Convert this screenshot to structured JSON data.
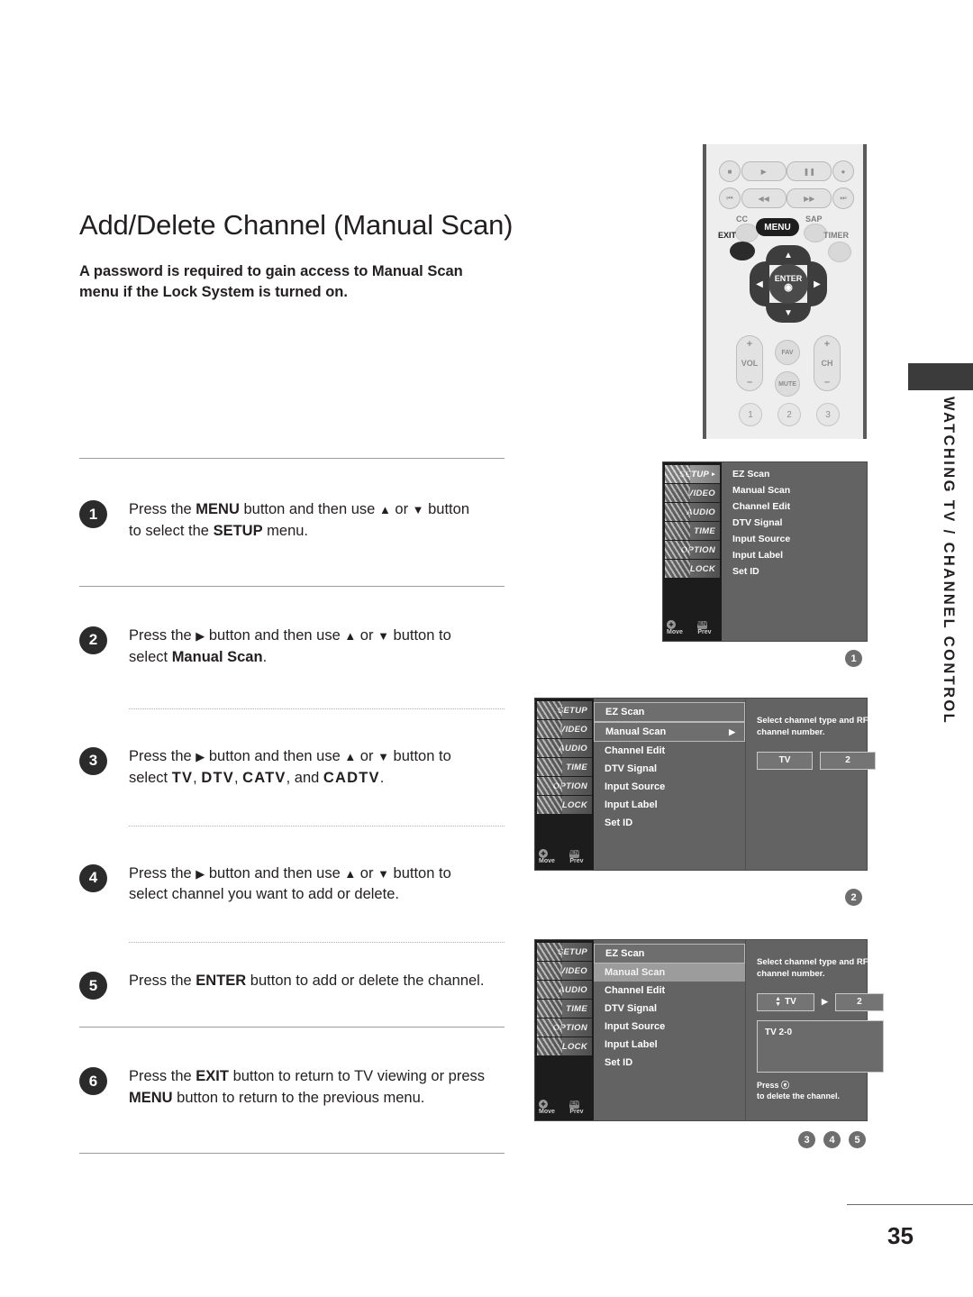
{
  "page": {
    "title": "Add/Delete Channel (Manual Scan)",
    "intro": "A password is required to gain access to Manual Scan menu if the Lock System is turned on.",
    "number": "35",
    "side_tab": "WATCHING TV / CHANNEL CONTROL"
  },
  "steps": [
    {
      "num": "1",
      "parts": [
        {
          "t": "Press the ",
          "b": false
        },
        {
          "t": "MENU",
          "b": true
        },
        {
          "t": " button and then use ",
          "b": false
        },
        {
          "t": "▲",
          "b": false
        },
        {
          "t": " or ",
          "b": false
        },
        {
          "t": "▼",
          "b": false
        },
        {
          "t": " button to select the ",
          "b": false
        },
        {
          "t": "SETUP",
          "b": true
        },
        {
          "t": " menu.",
          "b": false
        }
      ],
      "text": "Press the MENU button and then use ▲ or ▼ button to select the SETUP menu."
    },
    {
      "num": "2",
      "text": "Press the ▶ button and then use ▲ or ▼ button to select Manual Scan."
    },
    {
      "num": "3",
      "text": "Press the ▶ button and then use ▲ or ▼ button to select TV, DTV, CATV, and CADTV."
    },
    {
      "num": "4",
      "text": "Press the ▶ button and then use ▲ or ▼ button to select channel you want to add or delete."
    },
    {
      "num": "5",
      "text": "Press the ENTER button to add or delete the channel."
    },
    {
      "num": "6",
      "text": "Press the EXIT button to return to TV viewing or press MENU button to return to the previous menu."
    }
  ],
  "remote": {
    "transport_row1": [
      "stop",
      "play",
      "pause",
      "record"
    ],
    "transport_row2": [
      "skip-back",
      "rewind",
      "fast-forward",
      "skip-forward"
    ],
    "cc_label": "CC",
    "sap_label": "SAP",
    "timer_label": "TIMER",
    "exit_label": "EXIT",
    "menu_label": "MENU",
    "enter_label": "ENTER",
    "vol_label": "VOL",
    "ch_label": "CH",
    "fav_label": "FAV",
    "mute_label": "MUTE",
    "plus": "+",
    "minus": "–",
    "numbers": [
      "1",
      "2",
      "3"
    ]
  },
  "osd": {
    "side_menu": [
      {
        "label": "SETUP",
        "active": true
      },
      {
        "label": "VIDEO",
        "active": false
      },
      {
        "label": "AUDIO",
        "active": false
      },
      {
        "label": "TIME",
        "active": false
      },
      {
        "label": "OPTION",
        "active": false
      },
      {
        "label": "LOCK",
        "active": false
      }
    ],
    "nav_move": "Move",
    "nav_prev": "Prev",
    "nav_prev_key": "MENU",
    "items": [
      "EZ Scan",
      "Manual Scan",
      "Channel Edit",
      "DTV Signal",
      "Input Source",
      "Input Label",
      "Set ID"
    ],
    "caret": "▸",
    "arrow_right": "▶",
    "screen1": {
      "marker": "1"
    },
    "screen2": {
      "marker": "2",
      "detail_text": "Select channel type and RF-channel number.",
      "field_type": "TV",
      "field_channel": "2"
    },
    "screen3": {
      "markers": [
        "3",
        "4",
        "5"
      ],
      "detail_text": "Select channel type and RF-channel number.",
      "field_type": "TV",
      "field_channel": "2",
      "result": "TV 2-0",
      "hint_line1": "Press ⓔ",
      "hint_line2": "to delete the channel."
    }
  },
  "colors": {
    "accent_dark": "#3b3b3b",
    "badge": "#5c5c5c",
    "osd_bg": "#636363",
    "osd_side": "#1c1c1c"
  }
}
